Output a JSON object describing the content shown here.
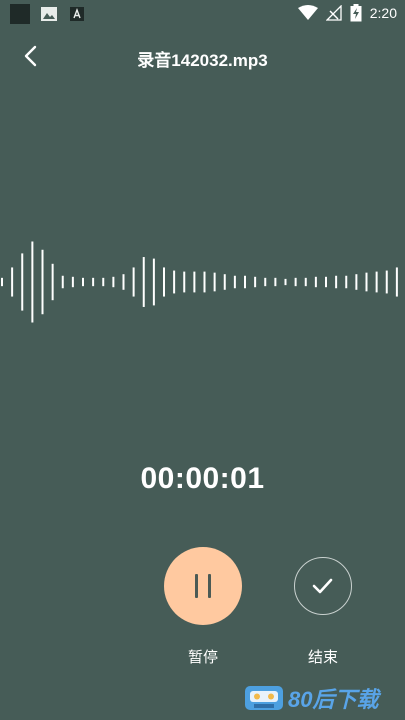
{
  "status_bar": {
    "time": "2:20",
    "left_icons": [
      "app-square-icon",
      "image-icon",
      "font-icon"
    ],
    "right_icons": [
      "wifi-icon",
      "no-signal-icon",
      "battery-charging-icon"
    ]
  },
  "header": {
    "back_icon": "chevron-left-icon",
    "title": "录音142032.mp3"
  },
  "recording": {
    "elapsed": "00:00:01",
    "waveform_amplitudes": [
      0.08,
      0.28,
      0.55,
      0.78,
      0.62,
      0.35,
      0.12,
      0.1,
      0.08,
      0.08,
      0.08,
      0.1,
      0.15,
      0.28,
      0.48,
      0.45,
      0.28,
      0.22,
      0.2,
      0.2,
      0.2,
      0.18,
      0.15,
      0.12,
      0.12,
      0.1,
      0.08,
      0.08,
      0.06,
      0.08,
      0.08,
      0.1,
      0.1,
      0.12,
      0.12,
      0.15,
      0.18,
      0.2,
      0.22,
      0.28
    ]
  },
  "controls": {
    "pause_label": "暂停",
    "stop_label": "结束"
  },
  "watermark": {
    "text": "80后下载"
  },
  "colors": {
    "background": "#465c57",
    "pause_button": "#ffc9a0",
    "watermark": "#59a4e8"
  }
}
